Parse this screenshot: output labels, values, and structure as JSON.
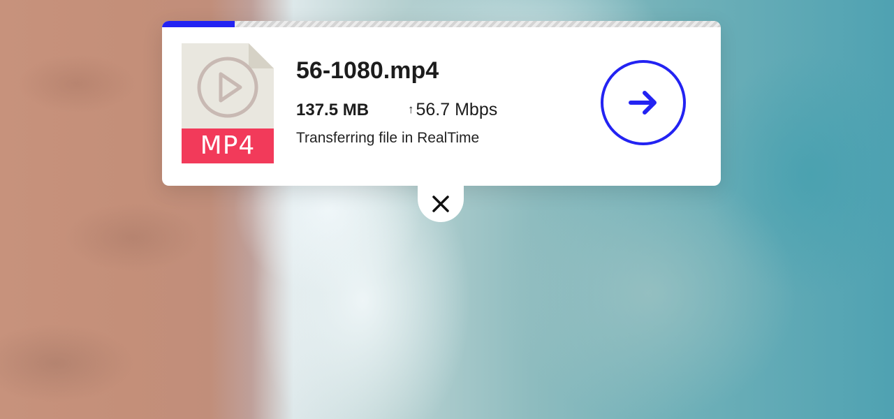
{
  "transfer": {
    "file_name": "56-1080.mp4",
    "file_type_label": "MP4",
    "file_size": "137.5 MB",
    "speed_arrow": "↑",
    "speed": "56.7 Mbps",
    "status_text": "Transferring file in RealTime",
    "progress_fraction": 0.13
  },
  "icons": {
    "file": "video-file-icon",
    "play": "play-icon",
    "open": "arrow-right-icon",
    "close": "close-icon"
  },
  "colors": {
    "accent": "#2323f2",
    "file_badge": "#f23a5a",
    "file_body": "#e9e7df",
    "file_fold": "#d6d2c6",
    "play_stroke": "#c8b9b3"
  }
}
